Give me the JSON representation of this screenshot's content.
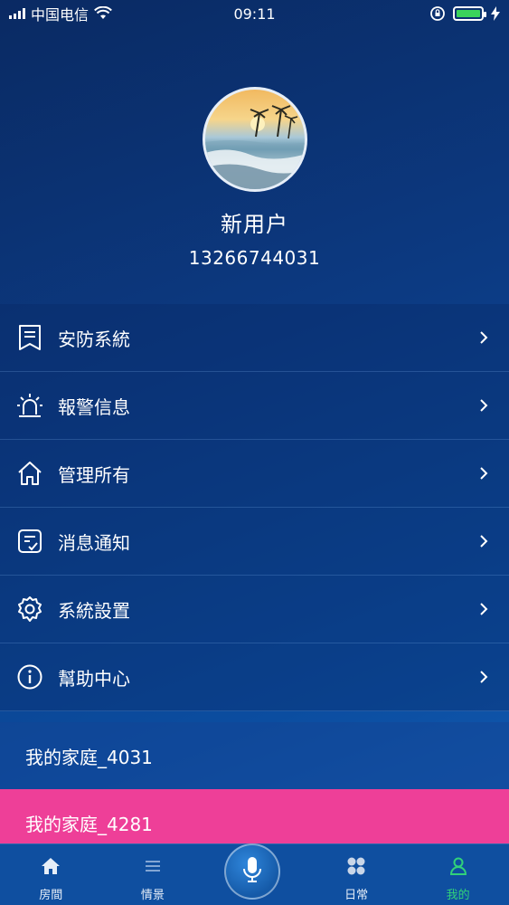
{
  "status_bar": {
    "carrier": "中国电信",
    "time": "09:11",
    "battery_level": 1.0,
    "battery_color": "#3bd35b"
  },
  "profile": {
    "name": "新用户",
    "phone": "13266744031"
  },
  "menu": {
    "items": [
      {
        "label": "安防系統",
        "icon": "bookmark-list-icon"
      },
      {
        "label": "報警信息",
        "icon": "alarm-siren-icon"
      },
      {
        "label": "管理所有",
        "icon": "home-icon"
      },
      {
        "label": "消息通知",
        "icon": "message-check-icon"
      },
      {
        "label": "系統設置",
        "icon": "gear-icon"
      },
      {
        "label": "幫助中心",
        "icon": "info-icon"
      }
    ]
  },
  "families": [
    {
      "label": "我的家庭_4031",
      "selected": false
    },
    {
      "label": "我的家庭_4281",
      "selected": true
    }
  ],
  "tabs": [
    {
      "label": "房間",
      "icon": "home-icon"
    },
    {
      "label": "情景",
      "icon": "list-icon"
    },
    {
      "label": "日常",
      "icon": "grid-icon"
    },
    {
      "label": "我的",
      "icon": "user-icon",
      "active": true
    }
  ],
  "colors": {
    "accent_pink": "#ee3f98",
    "tab_active": "#31d27a"
  }
}
